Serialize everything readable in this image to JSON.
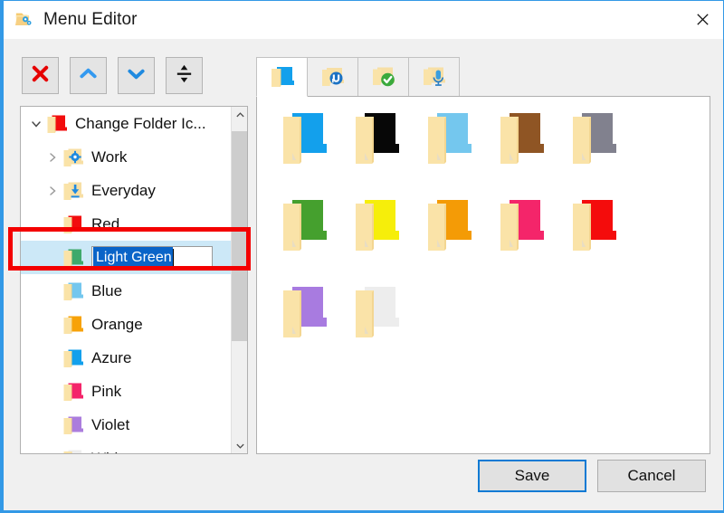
{
  "window": {
    "title": "Menu Editor",
    "title_icon": "folder-gears-icon",
    "close_label": "✕",
    "accent_color": "#0a7ad4",
    "border_color": "#3399e6"
  },
  "toolbar": {
    "buttons": [
      {
        "name": "delete-button",
        "icon": "x-icon",
        "color": "#e60000"
      },
      {
        "name": "move-up-button",
        "icon": "chevron-up-icon",
        "color": "#3399f0"
      },
      {
        "name": "move-down-button",
        "icon": "chevron-down-icon",
        "color": "#1f8ae0"
      },
      {
        "name": "add-separator-button",
        "icon": "separator-icon",
        "color": "#000000"
      }
    ]
  },
  "tabs": [
    {
      "name": "tab-folder-color",
      "icon": "blue-folder-icon",
      "active": true
    },
    {
      "name": "tab-folder-app",
      "icon": "folder-utorrent-icon",
      "active": false
    },
    {
      "name": "tab-folder-status",
      "icon": "folder-check-icon",
      "active": false
    },
    {
      "name": "tab-folder-media",
      "icon": "folder-microphone-icon",
      "active": false
    }
  ],
  "tree": {
    "items": [
      {
        "label": "Change Folder Ic...",
        "depth": 0,
        "twisty": "expanded",
        "icon": "folder-red-icon",
        "color": "#f20d0d",
        "editing": false
      },
      {
        "label": "Work",
        "depth": 1,
        "twisty": "collapsed",
        "icon": "folder-gear-icon",
        "color": "#f7dfa5",
        "editing": false
      },
      {
        "label": "Everyday",
        "depth": 1,
        "twisty": "collapsed",
        "icon": "folder-download-icon",
        "color": "#f7dfa5",
        "editing": false
      },
      {
        "label": "Red",
        "depth": 1,
        "twisty": "none",
        "icon": "folder-red-icon",
        "color": "#f20d0d",
        "editing": false
      },
      {
        "label": "Light Green",
        "depth": 1,
        "twisty": "none",
        "icon": "folder-green-icon",
        "color": "#3fa96b",
        "editing": true
      },
      {
        "label": "Blue",
        "depth": 1,
        "twisty": "none",
        "icon": "folder-lightblue-icon",
        "color": "#74c7ee",
        "editing": false
      },
      {
        "label": "Orange",
        "depth": 1,
        "twisty": "none",
        "icon": "folder-orange-icon",
        "color": "#f7a208",
        "editing": false
      },
      {
        "label": "Azure",
        "depth": 1,
        "twisty": "none",
        "icon": "folder-azure-icon",
        "color": "#13a0ec",
        "editing": false
      },
      {
        "label": "Pink",
        "depth": 1,
        "twisty": "none",
        "icon": "folder-pink-icon",
        "color": "#f4256a",
        "editing": false
      },
      {
        "label": "Violet",
        "depth": 1,
        "twisty": "none",
        "icon": "folder-violet-icon",
        "color": "#ab7ddd",
        "editing": false
      },
      {
        "label": "White",
        "depth": 1,
        "twisty": "none",
        "icon": "folder-white-icon",
        "color": "#eeeeee",
        "editing": false
      }
    ],
    "editing_value": "Light Green",
    "editing_selected": true,
    "selection_color": "#0a64c8",
    "row_highlight_color": "#cce8f7",
    "scrollbar": {
      "up_arrow": "⌃",
      "down_arrow": "⌄"
    }
  },
  "icon_grid": {
    "icons": [
      {
        "name": "folder-azure-icon",
        "label": "Azure",
        "color": "#13a0ec"
      },
      {
        "name": "folder-black-icon",
        "label": "Black",
        "color": "#070707"
      },
      {
        "name": "folder-lightblue-icon",
        "label": "Light Blue",
        "color": "#74c7ee"
      },
      {
        "name": "folder-brown-icon",
        "label": "Brown",
        "color": "#8f5524"
      },
      {
        "name": "folder-gray-icon",
        "label": "Gray",
        "color": "#81818e"
      },
      {
        "name": "folder-green-icon",
        "label": "Green",
        "color": "#45a02e"
      },
      {
        "name": "folder-yellow-icon",
        "label": "Yellow",
        "color": "#f6ee0a"
      },
      {
        "name": "folder-orange-icon",
        "label": "Orange",
        "color": "#f49b06"
      },
      {
        "name": "folder-pink-icon",
        "label": "Pink",
        "color": "#f4256a"
      },
      {
        "name": "folder-red-icon",
        "label": "Red",
        "color": "#f40c0c"
      },
      {
        "name": "folder-violet-icon",
        "label": "Violet",
        "color": "#a87be0"
      },
      {
        "name": "folder-white-icon",
        "label": "White",
        "color": "#ededed"
      }
    ]
  },
  "footer": {
    "save_label": "Save",
    "cancel_label": "Cancel"
  },
  "annotation": {
    "shape": "rectangle",
    "color": "#f40000",
    "target": "Light Green rename field"
  }
}
